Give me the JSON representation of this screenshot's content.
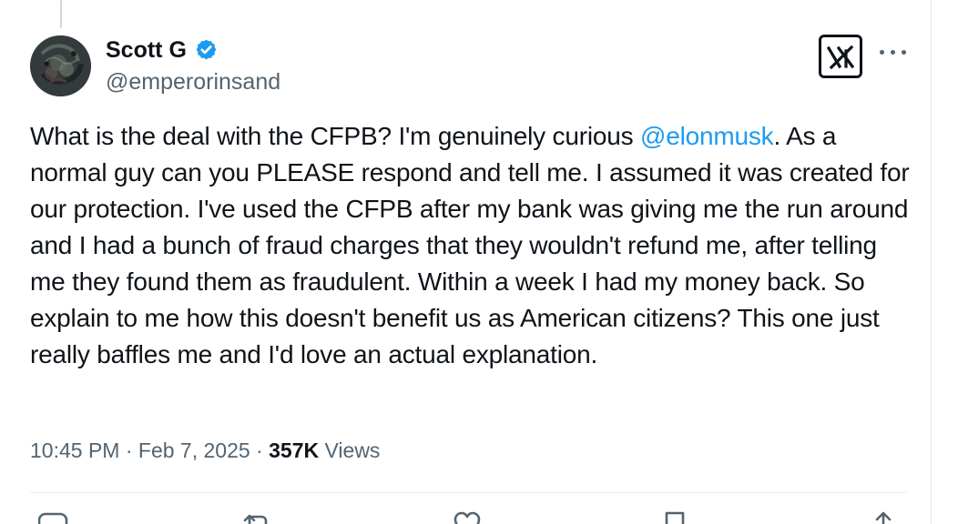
{
  "tweet": {
    "author": {
      "display_name": "Scott G",
      "handle": "@emperorinsand"
    },
    "text": {
      "before_mention": "What is the deal with the CFPB? I'm genuinely curious ",
      "mention": "@elonmusk",
      "after_mention": ". As a normal guy can you PLEASE respond and tell me. I assumed it was created for our protection. I've used the CFPB after my bank was giving me the run around and I had a bunch of fraud charges that they wouldn't refund me, after telling me they found them as fraudulent. Within a week I had my money back. So explain to me how this doesn't benefit us as American citizens? This one just really baffles me and I'd love an actual explanation."
    },
    "metadata": {
      "time": "10:45 PM",
      "separator_1": " · ",
      "date": "Feb 7, 2025",
      "separator_2": " · ",
      "views_count": "357K",
      "views_label": " Views"
    }
  },
  "icons": {
    "verified": "verified-badge-icon",
    "grok": "grok-icon",
    "more": "more-icon",
    "reply": "reply-icon",
    "repost": "repost-icon",
    "like": "like-icon",
    "bookmark": "bookmark-icon",
    "share": "share-icon"
  },
  "colors": {
    "text": "#0f1419",
    "secondary_text": "#536471",
    "link": "#1d9bf0",
    "border": "#e8ecef"
  }
}
